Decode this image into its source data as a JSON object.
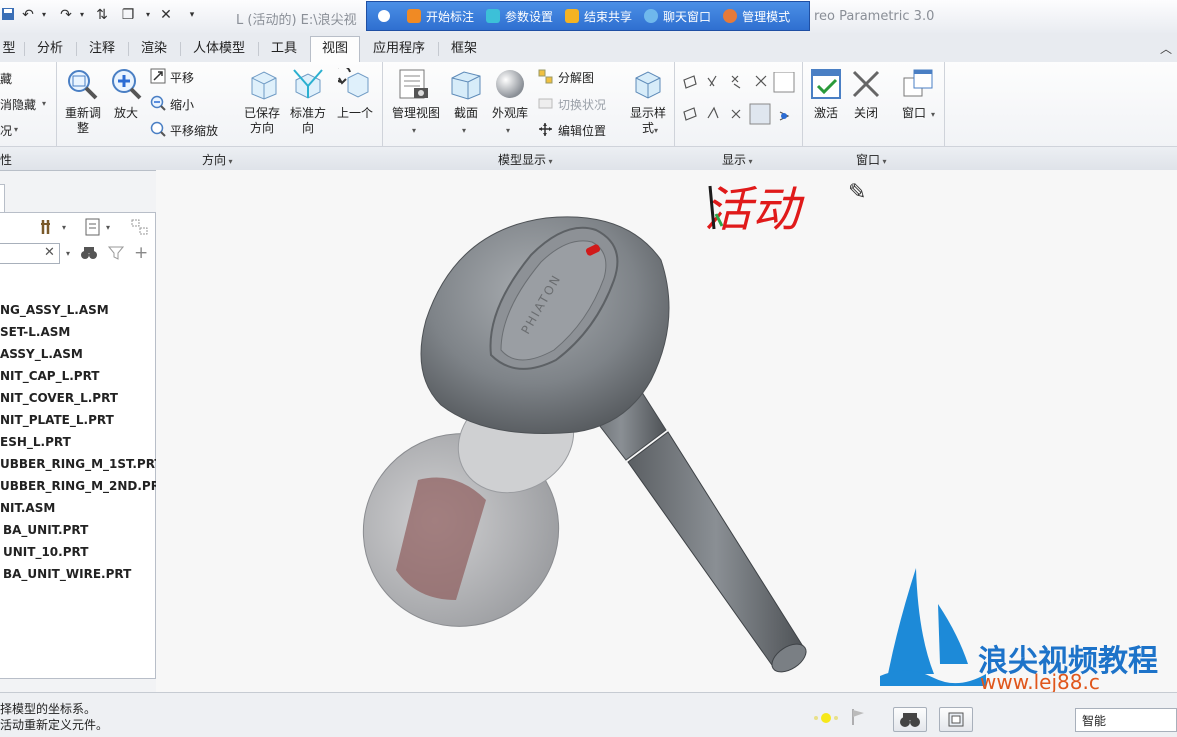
{
  "window": {
    "title_left": "L (活动的) E:\\浪尖视",
    "title_right": "reo Parametric 3.0"
  },
  "share_toolbar": {
    "items": [
      {
        "label": "开始标注",
        "color": "#f08a24"
      },
      {
        "label": "参数设置",
        "color": "#3cc0d8"
      },
      {
        "label": "结束共享",
        "color": "#f4b323"
      },
      {
        "label": "聊天窗口",
        "color": "#6fb8ec"
      },
      {
        "label": "管理模式",
        "color": "#e67a3a"
      }
    ]
  },
  "tabs": [
    {
      "label": "型"
    },
    {
      "label": "分析"
    },
    {
      "label": "注释"
    },
    {
      "label": "渲染"
    },
    {
      "label": "人体模型"
    },
    {
      "label": "工具"
    },
    {
      "label": "视图"
    },
    {
      "label": "应用程序"
    },
    {
      "label": "框架"
    }
  ],
  "active_tab": "视图",
  "ribbon": {
    "left_partial": [
      "藏",
      "消隐藏",
      "况"
    ],
    "orientation": {
      "refit": "重新调\n整",
      "zoom_in": "放大",
      "pan": "平移",
      "zoom_out": "缩小",
      "pan_zoom": "平移缩放",
      "saved_orientations": "已保存\n方向",
      "standard_orientation": "标准方\n向",
      "previous": "上一个"
    },
    "model_display": {
      "manage_views": "管理视图",
      "section": "截面",
      "appearance": "外观库",
      "exploded_view": "分解图",
      "toggle_status": "切换状况",
      "edit_position": "编辑位置",
      "display_style": "显示样\n式"
    },
    "window_group": {
      "activate": "激活",
      "close": "关闭",
      "windows": "窗口"
    },
    "group_labels": {
      "partial_left": "性",
      "orientation": "方向",
      "model_display": "模型显示",
      "show": "显示",
      "window": "窗口"
    }
  },
  "model_tree": {
    "items": [
      "NG_ASSY_L.ASM",
      "SET-L.ASM",
      "ASSY_L.ASM",
      "NIT_CAP_L.PRT",
      "NIT_COVER_L.PRT",
      "NIT_PLATE_L.PRT",
      "ESH_L.PRT",
      "UBBER_RING_M_1ST.PRT",
      "UBBER_RING_M_2ND.PRT",
      "NIT.ASM",
      "BA_UNIT.PRT",
      "UNIT_10.PRT",
      "BA_UNIT_WIRE.PRT"
    ]
  },
  "viewport": {
    "annotation_text": "活动",
    "model_brand": "PHIATON",
    "watermark_text": "浪尖视频教程",
    "watermark_url": "www.lej88.c",
    "annotation_color": "#e01a1a"
  },
  "status_bar": {
    "message_1": "择模型的坐标系。",
    "message_2": "活动重新定义元件。",
    "filter": "智能"
  }
}
